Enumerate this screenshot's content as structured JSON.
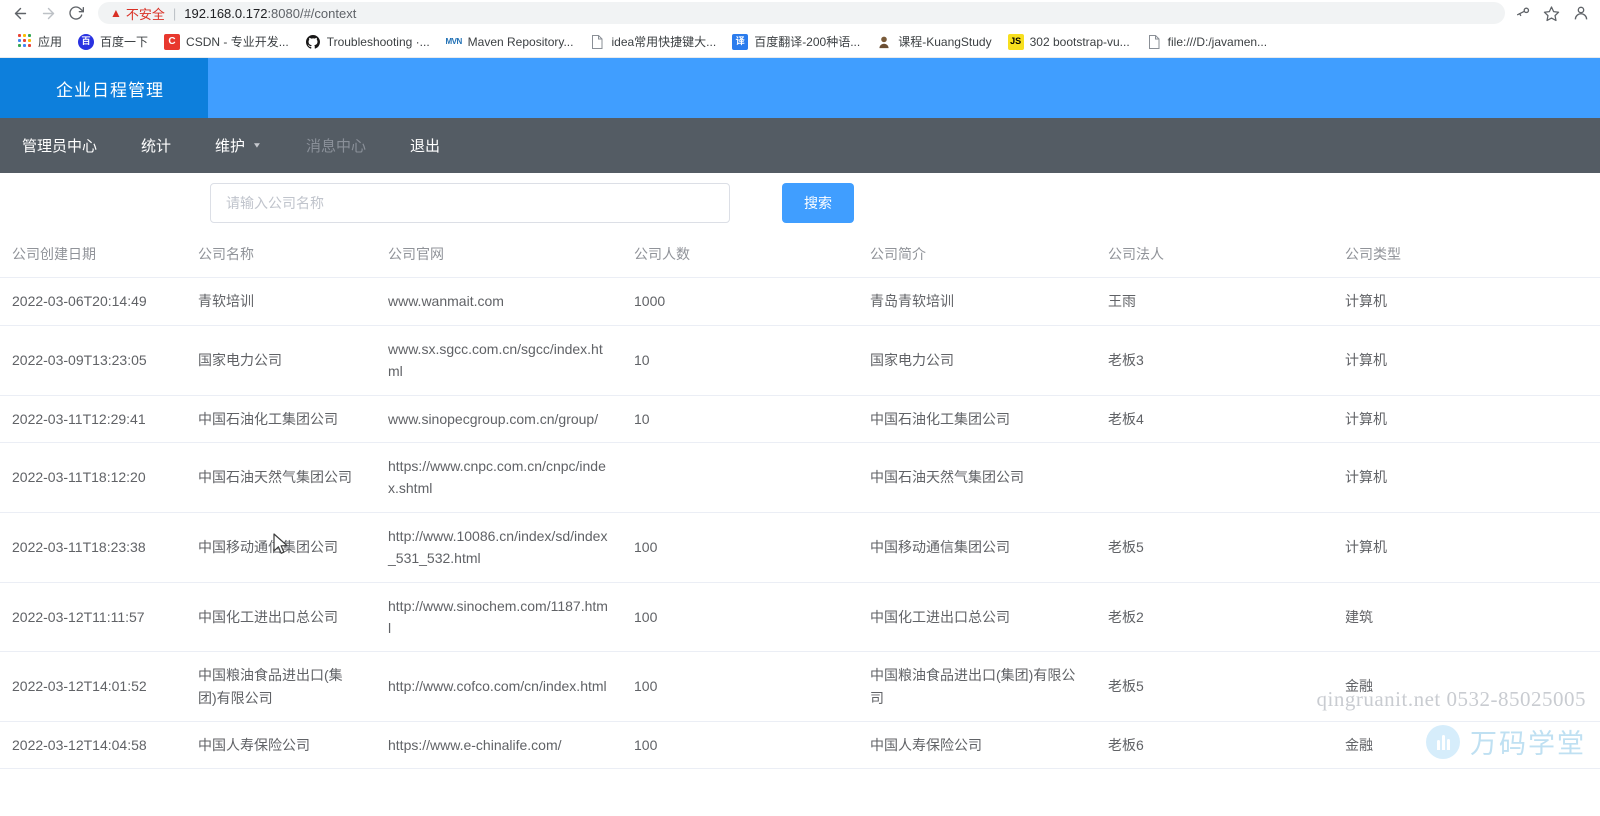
{
  "browser": {
    "nav": {
      "back_icon": "arrow-left-icon",
      "forward_icon": "arrow-right-icon",
      "reload_icon": "reload-icon"
    },
    "omnibox": {
      "security_icon": "warning-triangle-icon",
      "security_label": "不安全",
      "url_host": "192.168.0.172",
      "url_rest": ":8080/#/context"
    },
    "toolbar_right": [
      {
        "name": "password-key-icon",
        "glyph": "⚷"
      },
      {
        "name": "bookmark-star-icon",
        "glyph": "☆"
      },
      {
        "name": "profile-avatar-icon",
        "glyph": "●"
      }
    ],
    "bookmarks": [
      {
        "label": "应用",
        "icon": "apps-grid-icon"
      },
      {
        "label": "百度一下",
        "icon": "baidu-icon",
        "glyph": "百"
      },
      {
        "label": "CSDN - 专业开发...",
        "icon": "csdn-icon",
        "glyph": "C"
      },
      {
        "label": "Troubleshooting ·...",
        "icon": "github-icon",
        "glyph": "●"
      },
      {
        "label": "Maven Repository...",
        "icon": "maven-icon",
        "glyph": "MVN"
      },
      {
        "label": "idea常用快捷键大...",
        "icon": "page-icon",
        "glyph": "🗋"
      },
      {
        "label": "百度翻译-200种语...",
        "icon": "baidu-fanyi-icon",
        "glyph": "译"
      },
      {
        "label": "课程-KuangStudy",
        "icon": "kuangstudy-icon",
        "glyph": "👤"
      },
      {
        "label": "302 bootstrap-vu...",
        "icon": "js-icon",
        "glyph": "JS"
      },
      {
        "label": "file:///D:/javamen...",
        "icon": "page-icon",
        "glyph": "🗋"
      }
    ]
  },
  "app": {
    "brand_title": "企业日程管理",
    "nav_items": [
      {
        "label": "管理员中心",
        "disabled": false,
        "has_caret": false
      },
      {
        "label": "统计",
        "disabled": false,
        "has_caret": false
      },
      {
        "label": "维护",
        "disabled": false,
        "has_caret": true
      },
      {
        "label": "消息中心",
        "disabled": true,
        "has_caret": false
      },
      {
        "label": "退出",
        "disabled": false,
        "has_caret": false
      }
    ],
    "search": {
      "placeholder": "请输入公司名称",
      "value": "",
      "button_label": "搜索"
    },
    "table": {
      "columns": [
        "公司创建日期",
        "公司名称",
        "公司官网",
        "公司人数",
        "公司简介",
        "公司法人",
        "公司类型"
      ],
      "rows": [
        {
          "created": "2022-03-06T20:14:49",
          "name": "青软培训",
          "site": "www.wanmait.com",
          "headcount": "1000",
          "desc": "青岛青软培训",
          "legal": "王雨",
          "type": "计算机"
        },
        {
          "created": "2022-03-09T13:23:05",
          "name": "国家电力公司",
          "site": "www.sx.sgcc.com.cn/sgcc/index.html",
          "headcount": "10",
          "desc": "国家电力公司",
          "legal": "老板3",
          "type": "计算机"
        },
        {
          "created": "2022-03-11T12:29:41",
          "name": "中国石油化工集团公司",
          "site": "www.sinopecgroup.com.cn/group/",
          "headcount": "10",
          "desc": "中国石油化工集团公司",
          "legal": "老板4",
          "type": "计算机"
        },
        {
          "created": "2022-03-11T18:12:20",
          "name": "中国石油天然气集团公司",
          "site": "https://www.cnpc.com.cn/cnpc/index.shtml",
          "headcount": "",
          "desc": "中国石油天然气集团公司",
          "legal": "",
          "type": "计算机"
        },
        {
          "created": "2022-03-11T18:23:38",
          "name": "中国移动通信集团公司",
          "site": "http://www.10086.cn/index/sd/index_531_532.html",
          "headcount": "100",
          "desc": "中国移动通信集团公司",
          "legal": "老板5",
          "type": "计算机"
        },
        {
          "created": "2022-03-12T11:11:57",
          "name": "中国化工进出口总公司",
          "site": "http://www.sinochem.com/1187.html",
          "headcount": "100",
          "desc": "中国化工进出口总公司",
          "legal": "老板2",
          "type": "建筑"
        },
        {
          "created": "2022-03-12T14:01:52",
          "name": "中国粮油食品进出口(集团)有限公司",
          "site": "http://www.cofco.com/cn/index.html",
          "headcount": "100",
          "desc": "中国粮油食品进出口(集团)有限公司",
          "legal": "老板5",
          "type": "金融"
        },
        {
          "created": "2022-03-12T14:04:58",
          "name": "中国人寿保险公司",
          "site": "https://www.e-chinalife.com/",
          "headcount": "100",
          "desc": "中国人寿保险公司",
          "legal": "老板6",
          "type": "金融"
        }
      ]
    },
    "watermark": {
      "text": "qingruanit.net 0532-85025005",
      "brand": "万码学堂"
    }
  },
  "colors": {
    "brand_dark_blue": "#0d7fdc",
    "brand_blue": "#409eff",
    "nav_gray": "#545c64",
    "text_gray": "#606266",
    "header_gray": "#909399",
    "insecure_red": "#d93025"
  }
}
